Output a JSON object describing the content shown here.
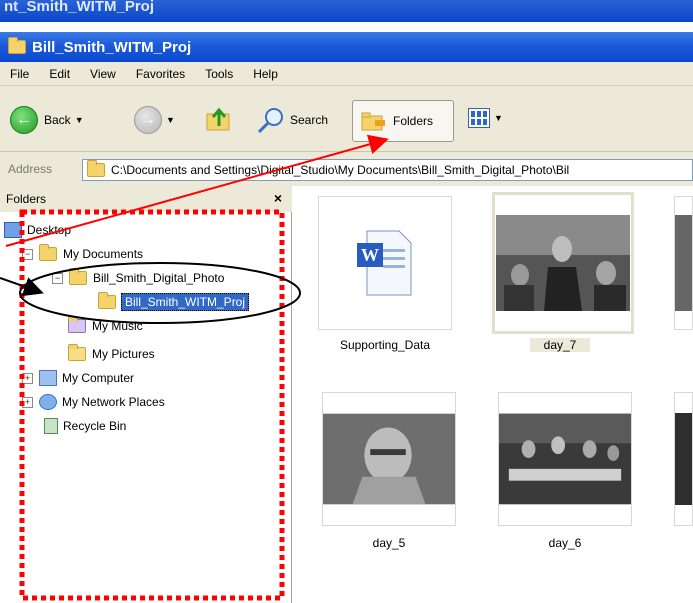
{
  "window": {
    "prev_title": "nt_Smith_WITM_Proj",
    "title": "Bill_Smith_WITM_Proj"
  },
  "menu": [
    "File",
    "Edit",
    "View",
    "Favorites",
    "Tools",
    "Help"
  ],
  "toolbar": {
    "back_label": "Back",
    "search_label": "Search",
    "folders_label": "Folders"
  },
  "address": {
    "label": "Address",
    "value": "C:\\Documents and Settings\\Digital_Studio\\My Documents\\Bill_Smith_Digital_Photo\\Bil"
  },
  "folders_pane": {
    "header": "Folders",
    "close": "×",
    "tree": {
      "desktop": "Desktop",
      "my_documents": "My Documents",
      "digital_photo": "Bill_Smith_Digital_Photo",
      "witm_proj": "Bill_Smith_WITM_Proj",
      "my_music": "My Music",
      "my_pictures": "My Pictures",
      "my_computer": "My Computer",
      "my_network": "My Network Places",
      "recycle_bin": "Recycle Bin"
    }
  },
  "content": {
    "items": [
      "Supporting_Data",
      "day_7",
      "day_5",
      "day_6"
    ]
  },
  "colors": {
    "annotation_red": "#ff0000",
    "selection_blue": "#316ac5",
    "xp_title_blue": "#0a49cf"
  }
}
